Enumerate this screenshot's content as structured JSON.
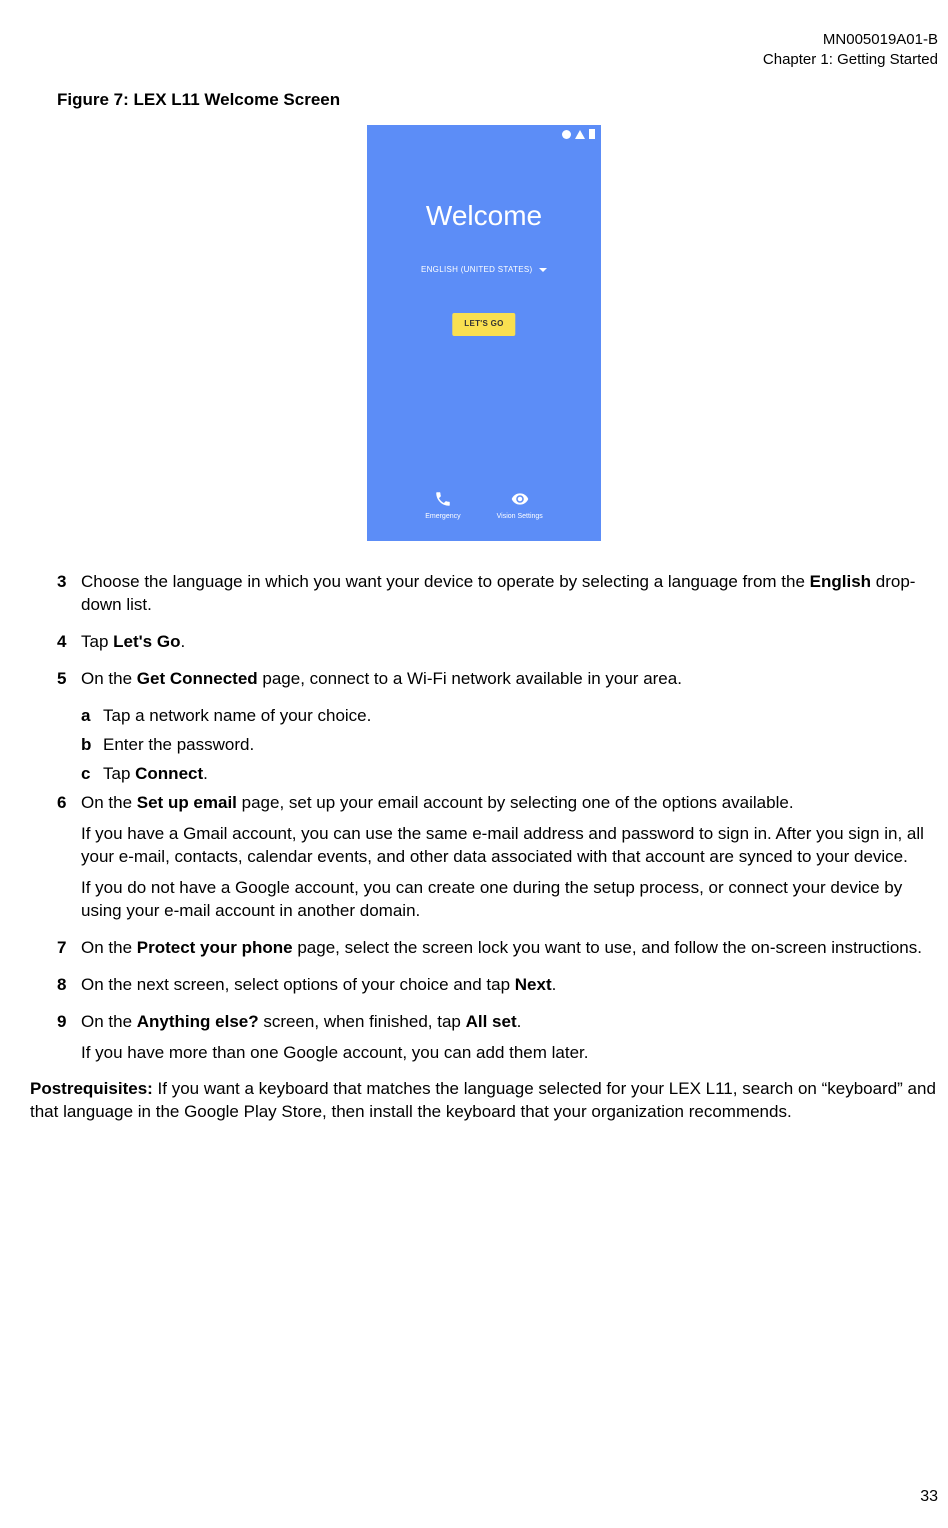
{
  "header": {
    "doc_id": "MN005019A01-B",
    "chapter": "Chapter 1:  Getting Started"
  },
  "figure": {
    "caption": "Figure 7: LEX L11 Welcome Screen",
    "welcome": "Welcome",
    "language": "ENGLISH (UNITED STATES)",
    "button": "LET'S GO",
    "emergency": "Emergency",
    "vision": "Vision Settings"
  },
  "steps": {
    "s3": {
      "num": "3",
      "text_a": "Choose the language in which you want your device to operate by selecting a language from the ",
      "bold": "English",
      "text_b": " drop-down list."
    },
    "s4": {
      "num": "4",
      "text_a": "Tap ",
      "bold": "Let's Go",
      "text_b": "."
    },
    "s5": {
      "num": "5",
      "text_a": "On the ",
      "bold": "Get Connected",
      "text_b": " page, connect to a Wi-Fi network available in your area.",
      "sub_a": {
        "letter": "a",
        "text": "Tap a network name of your choice."
      },
      "sub_b": {
        "letter": "b",
        "text": "Enter the password."
      },
      "sub_c": {
        "letter": "c",
        "text_a": "Tap ",
        "bold": "Connect",
        "text_b": "."
      }
    },
    "s6": {
      "num": "6",
      "text_a": "On the ",
      "bold": "Set up email",
      "text_b": " page, set up your email account by selecting one of the options available.",
      "para2": "If you have a Gmail account, you can use the same e-mail address and password to sign in. After you sign in, all your e-mail, contacts, calendar events, and other data associated with that account are synced to your device.",
      "para3": "If you do not have a Google account, you can create one during the setup process, or connect your device by using your e-mail account in another domain."
    },
    "s7": {
      "num": "7",
      "text_a": "On the ",
      "bold": "Protect your phone",
      "text_b": " page, select the screen lock you want to use, and follow the on-screen instructions."
    },
    "s8": {
      "num": "8",
      "text_a": "On the next screen, select options of your choice and tap ",
      "bold": "Next",
      "text_b": "."
    },
    "s9": {
      "num": "9",
      "text_a": "On the ",
      "bold1": "Anything else?",
      "text_b": " screen, when finished, tap ",
      "bold2": "All set",
      "text_c": ".",
      "para2": "If you have more than one Google account, you can add them later."
    }
  },
  "postreq": {
    "label": "Postrequisites:",
    "text": " If you want a keyboard that matches the language selected for your LEX L11, search on “keyboard” and that language in the Google Play Store, then install the keyboard that your organization recommends."
  },
  "page_number": "33"
}
